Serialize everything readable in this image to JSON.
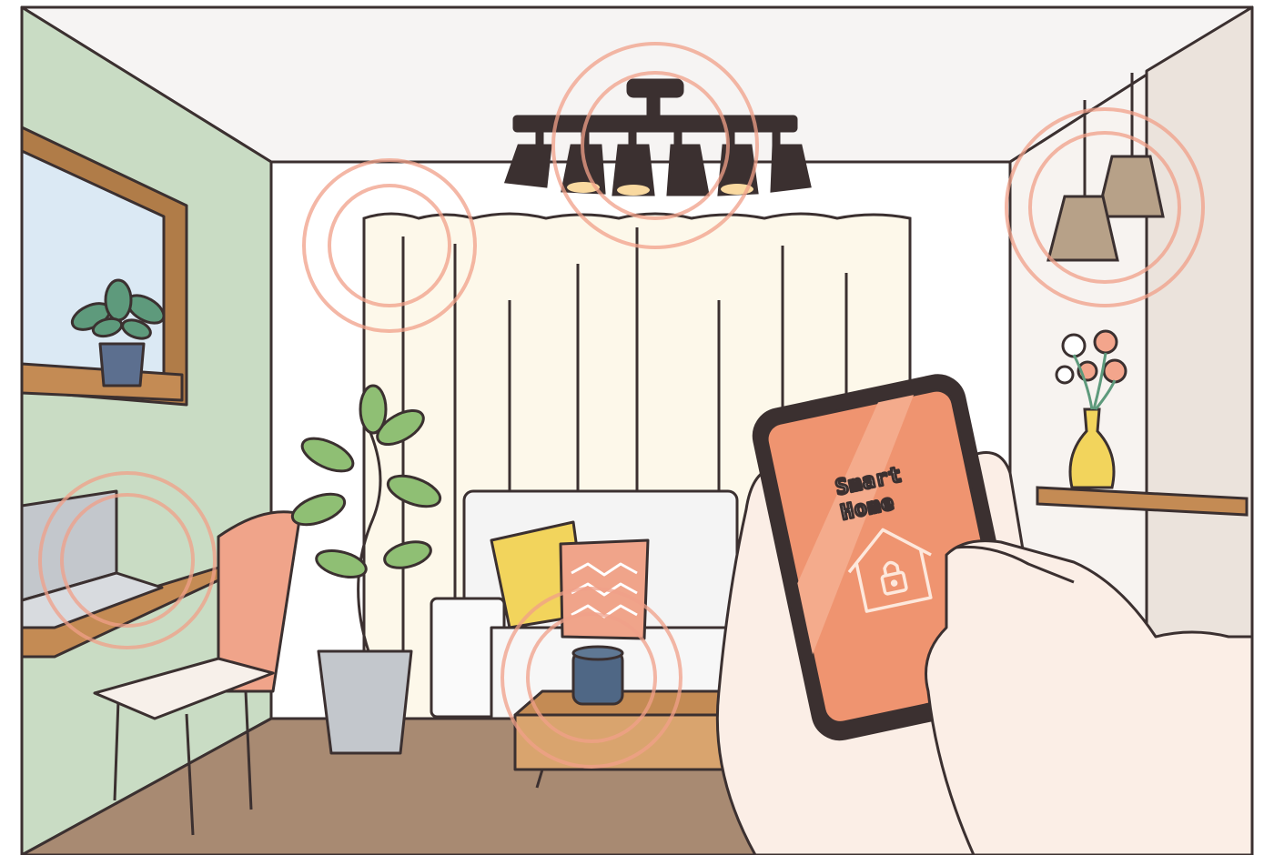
{
  "phone": {
    "title_line1": "Smart",
    "title_line2": "Home",
    "app_icon": "house-lock-icon"
  },
  "colors": {
    "accent_salmon": "#f0a48a",
    "signal_ring": "#f1a089",
    "wall_green": "#c9dcc4",
    "phone_screen": "#ef9470",
    "outline": "#3b3030"
  }
}
